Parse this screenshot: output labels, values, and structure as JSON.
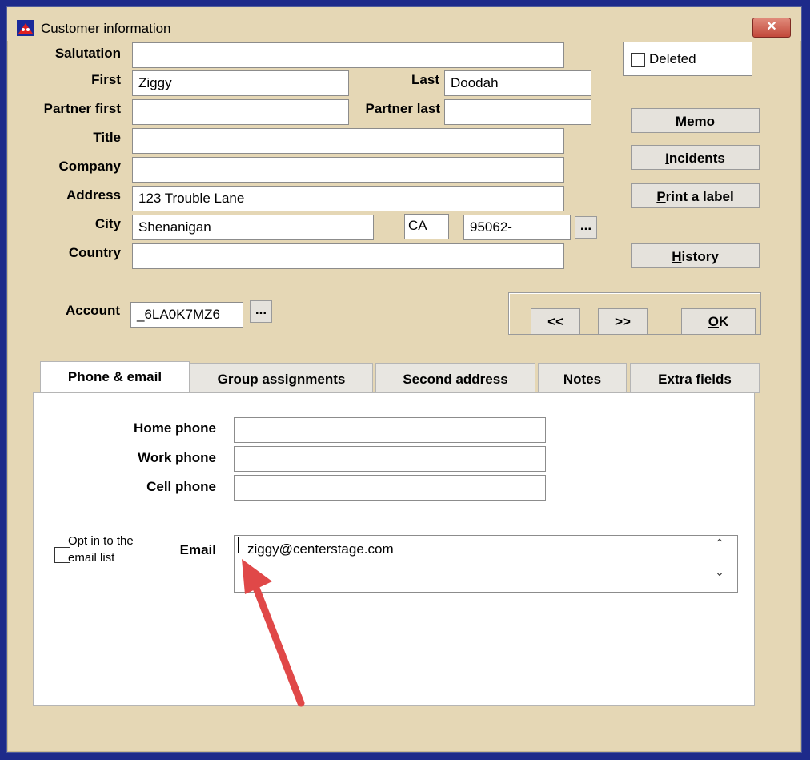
{
  "window": {
    "title": "Customer information",
    "close_label": "✕"
  },
  "labels": {
    "salutation": "Salutation",
    "first": "First",
    "last": "Last",
    "partner_first": "Partner first",
    "partner_last": "Partner last",
    "title": "Title",
    "company": "Company",
    "address": "Address",
    "city": "City",
    "country": "Country",
    "account": "Account"
  },
  "fields": {
    "salutation": "",
    "first": "Ziggy",
    "last": "Doodah",
    "partner_first": "",
    "partner_last": "",
    "title": "",
    "company": "",
    "address": "123 Trouble Lane",
    "city": "Shenanigan",
    "state": "CA",
    "zip": "95062-",
    "country": "",
    "account": "_6LA0K7MZ6"
  },
  "ellipsis": "...",
  "deleted": {
    "label": "Deleted",
    "checked": false
  },
  "side_buttons": {
    "memo_key": "M",
    "memo_rest": "emo",
    "incidents_key": "I",
    "incidents_rest": "ncidents",
    "print_key": "P",
    "print_rest": "rint a label",
    "history_key": "H",
    "history_rest": "istory"
  },
  "nav": {
    "prev": "<<",
    "next": ">>",
    "ok_key": "O",
    "ok_rest": "K"
  },
  "tabs": [
    {
      "label": "Phone & email",
      "active": true
    },
    {
      "label": "Group assignments",
      "active": false
    },
    {
      "label": "Second address",
      "active": false
    },
    {
      "label": "Notes",
      "active": false
    },
    {
      "label": "Extra fields",
      "active": false
    }
  ],
  "phone": {
    "home_label": "Home phone",
    "home_value": "",
    "work_label": "Work phone",
    "work_value": "",
    "cell_label": "Cell phone",
    "cell_value": ""
  },
  "email": {
    "label": "Email",
    "value": "ziggy@centerstage.com",
    "optin_line1": "Opt in to the",
    "optin_line2": "email list",
    "optin_checked": false
  },
  "colors": {
    "background": "#e5d7b5",
    "annotation_arrow": "#e04848",
    "window_border": "#1d2a8a"
  }
}
